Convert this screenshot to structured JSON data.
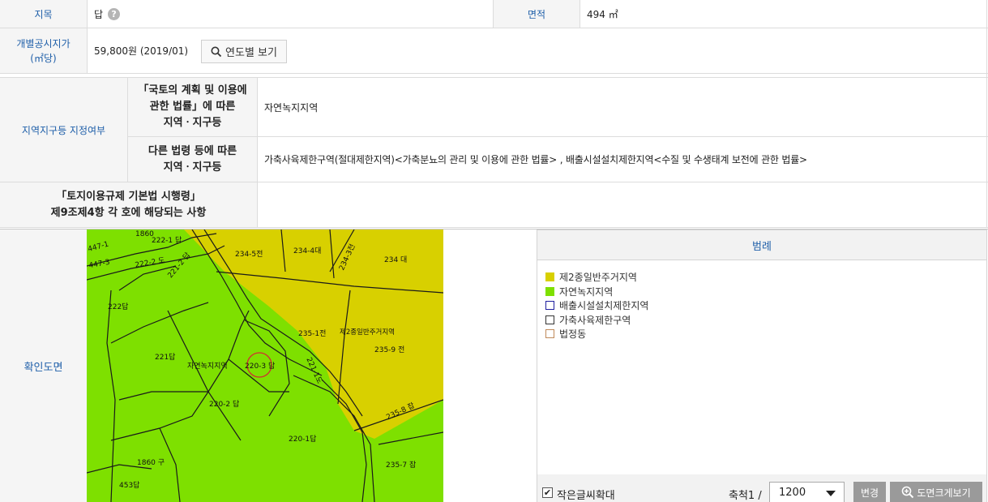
{
  "info": {
    "jimok_label": "지목",
    "jimok_value": "답",
    "area_label": "면적",
    "area_value": "494 ㎡",
    "price_label_line1": "개별공시지가",
    "price_label_line2": "(㎡당)",
    "price_value": "59,800원 (2019/01)",
    "year_button": "연도별 보기"
  },
  "zoning": {
    "section_label": "지역지구등 지정여부",
    "row1_label_line1": "「국토의 계획 및 이용에",
    "row1_label_line2": "관한 법률」에 따른",
    "row1_label_line3": "지역ㆍ지구등",
    "row1_value": "자연녹지지역",
    "row2_label_line1": "다른 법령 등에 따른",
    "row2_label_line2": "지역ㆍ지구등",
    "row2_value": "가축사육제한구역(절대제한지역)<가축분뇨의 관리 및 이용에 관한 법률> , 배출시설설치제한지역<수질 및 수생태계 보전에 관한 법률>",
    "row3_label_line1": "「토지이용규제 기본법 시행령」",
    "row3_label_line2": "제9조제4항 각 호에 해당되는 사항",
    "row3_value": ""
  },
  "map": {
    "section_label": "확인도면",
    "parcels": [
      "234-5전",
      "234-4대",
      "234-3전",
      "234 대",
      "222답",
      "221답",
      "자연녹지지역",
      "220-3 답",
      "235-1전",
      "제2종일반주거지역",
      "235-9 전",
      "221-1도",
      "220-2 답",
      "220-1답",
      "235-8 잡",
      "1860 구",
      "453답",
      "235-7 잡",
      "222-2 도",
      "221-2 답",
      "222-1 답",
      "447-1",
      "447-3",
      "1860"
    ],
    "colors": {
      "green": "#7ee000",
      "yellow": "#d8d000"
    }
  },
  "legend": {
    "title": "범례",
    "items": [
      {
        "label": "제2종일반주거지역",
        "fill": "#d8d000",
        "border": "#d8d000"
      },
      {
        "label": "자연녹지지역",
        "fill": "#7ee000",
        "border": "#7ee000"
      },
      {
        "label": "배출시설설치제한지역",
        "fill": "#ffffff",
        "border": "#1f1fa0"
      },
      {
        "label": "가축사육제한구역",
        "fill": "#ffffff",
        "border": "#333333"
      },
      {
        "label": "법정동",
        "fill": "#ffffff",
        "border": "#c08a5a"
      }
    ]
  },
  "controls": {
    "checkbox_label": "작은글씨확대",
    "checkbox_checked": true,
    "scale_label": "축척1 /",
    "scale_value": "1200",
    "change_button": "변경",
    "big_map_button": "도면크게보기"
  }
}
